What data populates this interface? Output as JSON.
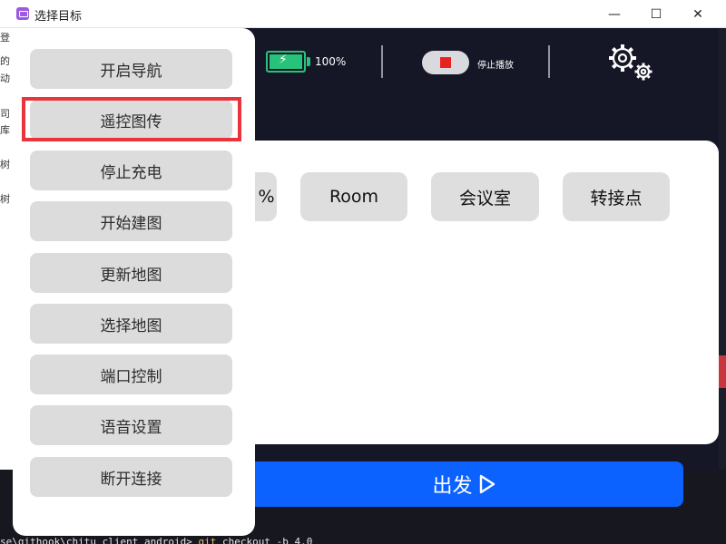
{
  "window": {
    "title": "选择目标",
    "minimize": "—",
    "maximize": "☐",
    "close": "✕"
  },
  "status": {
    "battery_percent": "100%",
    "battery_level": 1.0,
    "stop_label": "停止播放"
  },
  "targets": [
    "Room",
    "会议室",
    "转接点"
  ],
  "partial_target_glyph": "%",
  "go_button": {
    "label": "出发"
  },
  "menu": {
    "items": [
      "开启导航",
      "遥控图传",
      "停止充电",
      "开始建图",
      "更新地图",
      "选择地图",
      "端口控制",
      "语音设置",
      "断开连接"
    ],
    "highlighted_index": 1
  },
  "terminal": {
    "command_prefix": "se\\githook\\chitu_client_android> ",
    "command_git": "git",
    "command_rest": " checkout -b 4.0",
    "left_chars": [
      "登",
      "的",
      "动",
      "",
      "司",
      "库",
      "",
      "树",
      "",
      "树"
    ]
  },
  "colors": {
    "accent": "#0b62ff",
    "battery": "#28c37a",
    "stop": "#e8231f",
    "highlight": "#e8343a"
  }
}
